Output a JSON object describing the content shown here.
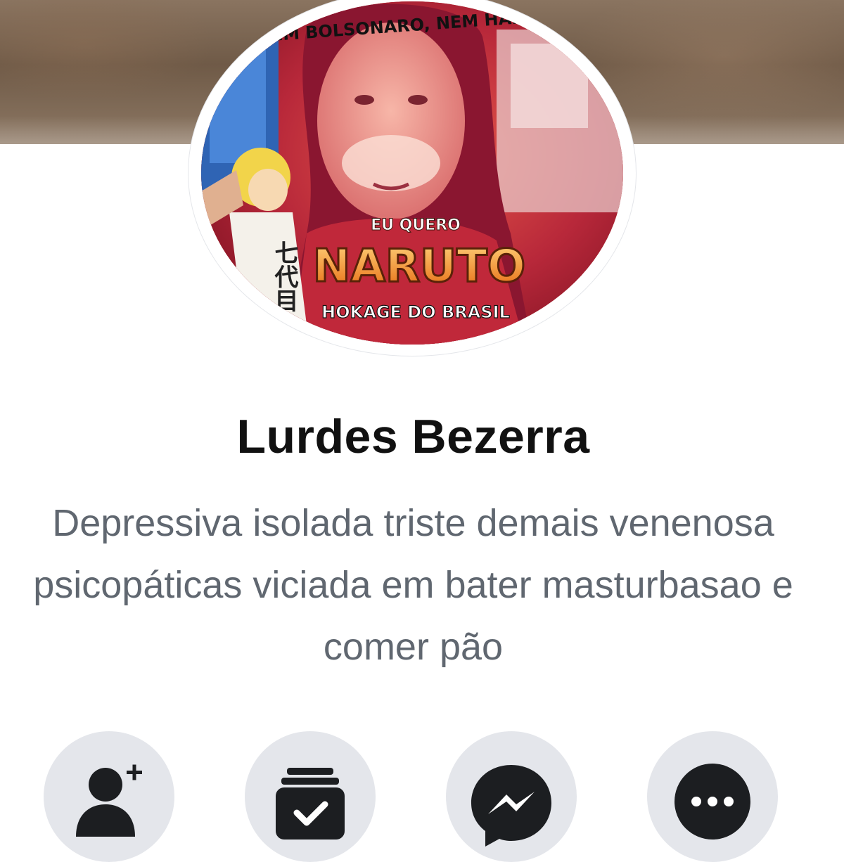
{
  "profile": {
    "name": "Lurdes Bezerra",
    "bio": "Depressiva isolada triste demais venenosa psicopáticas viciada em bater masturbasao e comer pão",
    "avatar": {
      "top_text": "NEM BOLSONARO, NEM HADDAD",
      "small_text": "EU QUERO",
      "big_text": "NARUTO",
      "bottom_text": "HOKAGE DO BRASIL",
      "kanji": "七代目"
    }
  },
  "actions": [
    {
      "icon": "add-friend-icon"
    },
    {
      "icon": "follow-check-icon"
    },
    {
      "icon": "messenger-icon"
    },
    {
      "icon": "more-options-icon"
    }
  ],
  "colors": {
    "icon": "#1c1e21",
    "button_bg": "#e4e6eb",
    "name": "#111111",
    "bio": "#606770",
    "naruto_text": "#f08a1c"
  }
}
